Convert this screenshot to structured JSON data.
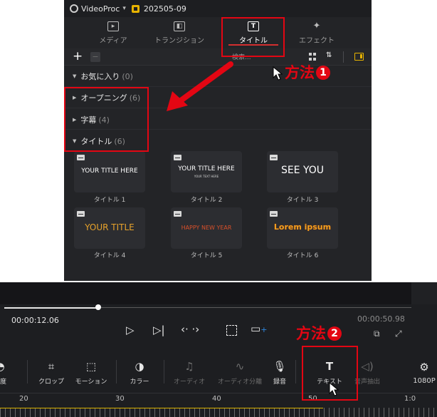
{
  "app": {
    "name": "VideoProc",
    "project": "202505-09"
  },
  "tabs": [
    {
      "label": "メディア",
      "icon": "media-icon"
    },
    {
      "label": "トランジション",
      "icon": "transition-icon"
    },
    {
      "label": "タイトル",
      "icon": "title-icon"
    },
    {
      "label": "エフェクト",
      "icon": "effect-icon"
    }
  ],
  "toolbar": {
    "add_label": "+",
    "remove_label": "−",
    "search_label": "検索..."
  },
  "categories": [
    {
      "name": "お気に入り",
      "count": "(0)"
    },
    {
      "name": "オープニング",
      "count": "(6)"
    },
    {
      "name": "字幕",
      "count": "(4)"
    },
    {
      "name": "タイトル",
      "count": "(6)"
    }
  ],
  "titles": [
    {
      "preview": "YOUR TITLE HERE",
      "label": "タイトル 1",
      "color": "#ffffff"
    },
    {
      "preview": "YOUR TITLE HERE",
      "sub": "YOUR TEXT HERE",
      "label": "タイトル 2",
      "color": "#ffffff"
    },
    {
      "preview": "SEE YOU",
      "label": "タイトル 3",
      "color": "#ffffff"
    },
    {
      "preview": "YOUR TITLE",
      "label": "タイトル 4",
      "color": "#e7a22b"
    },
    {
      "preview": "HAPPY NEW YEAR",
      "label": "タイトル 5",
      "color": "#d9502a"
    },
    {
      "preview": "Lorem ipsum",
      "label": "タイトル 6",
      "color": "#f0a020"
    }
  ],
  "annotations": {
    "method1": "方法",
    "method1_num": "1",
    "method2": "方法",
    "method2_num": "2"
  },
  "player": {
    "current_time": "00:00:12.06",
    "total_time": "00:00:50.98",
    "progress": 0.23
  },
  "tools": [
    {
      "label": "速度",
      "icon": "speed-icon",
      "enabled": true
    },
    {
      "label": "クロップ",
      "icon": "crop-icon",
      "enabled": true
    },
    {
      "label": "モーション",
      "icon": "motion-icon",
      "enabled": true
    },
    {
      "label": "カラー",
      "icon": "palette-icon",
      "enabled": true
    },
    {
      "label": "オーディオ",
      "icon": "audio-icon",
      "enabled": false
    },
    {
      "label": "オーディオ分離",
      "icon": "audio-split-icon",
      "enabled": false
    },
    {
      "label": "録音",
      "icon": "microphone-icon",
      "enabled": true
    },
    {
      "label": "テキスト",
      "icon": "text-icon",
      "enabled": true
    },
    {
      "label": "音声抽出",
      "icon": "speaker-icon",
      "enabled": false
    },
    {
      "label": "1080P",
      "icon": "settings-icon",
      "enabled": true
    }
  ],
  "ruler": [
    "20",
    "30",
    "40",
    "50",
    "1:0"
  ],
  "colors": {
    "accent": "#e7b300",
    "annotation": "#e30613",
    "panel": "#232427"
  }
}
